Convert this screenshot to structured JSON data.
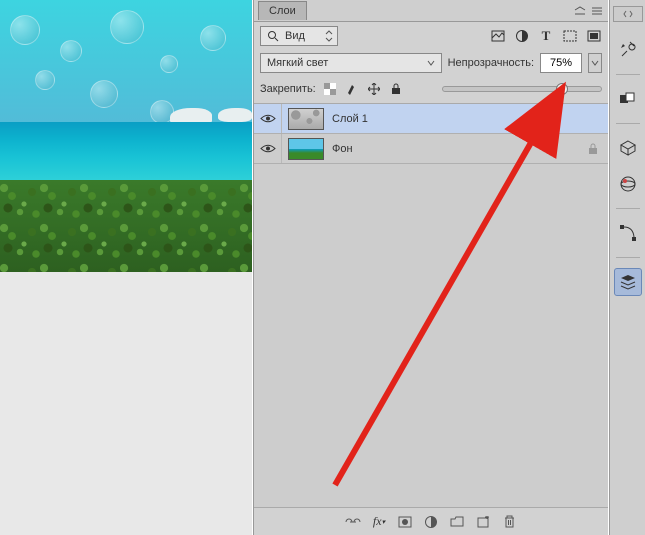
{
  "panel": {
    "title": "Слои",
    "view_label": "Вид",
    "blend_mode": "Мягкий свет",
    "opacity_label": "Непрозрачность:",
    "opacity_value": "75%",
    "lock_label": "Закрепить:"
  },
  "layers": [
    {
      "name": "Слой 1",
      "visible": true,
      "selected": true,
      "locked": false
    },
    {
      "name": "Фон",
      "visible": true,
      "selected": false,
      "locked": true
    }
  ],
  "icons": {
    "search": "search-icon",
    "image": "image-icon",
    "adjust": "adjust-icon",
    "type": "type-icon",
    "shape": "shape-icon",
    "smart": "smart-icon",
    "menu": "menu-icon",
    "eye": "eye-icon",
    "lock": "lock-icon",
    "checker": "checker-icon",
    "brush": "brush-icon",
    "move": "move-icon",
    "link": "link-icon",
    "fx": "fx-icon",
    "mask": "mask-icon",
    "fill": "fill-adjust-icon",
    "folder": "folder-icon",
    "new": "new-layer-icon",
    "trash": "trash-icon",
    "tools": "tools-icon",
    "color": "color-icon",
    "cube": "cube-icon",
    "sphere": "sphere-icon",
    "path": "path-icon",
    "layers_stack": "layers-stack-icon"
  },
  "slider": {
    "value": 75
  }
}
